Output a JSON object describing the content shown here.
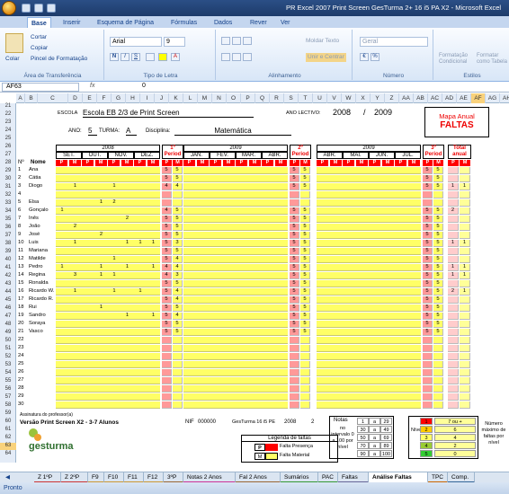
{
  "window": {
    "title": "PR Excel 2007 Print Screen GesTurma 2+ 16 i5 PA X2 - Microsoft Excel"
  },
  "ribbon_tabs": [
    "Base",
    "Inserir",
    "Esquema de Página",
    "Fórmulas",
    "Dados",
    "Rever",
    "Ver"
  ],
  "ribbon": {
    "paste": "Colar",
    "cut": "Cortar",
    "copy": "Copiar",
    "format_painter": "Pincel de Formatação",
    "clipboard_group": "Área de Transferência",
    "font_name": "Arial",
    "font_size": "9",
    "font_group": "Tipo de Letra",
    "wrap_text": "Moldar Texto",
    "merge_center": "Unir e Centrar",
    "alignment_group": "Alinhamento",
    "number_format": "Geral",
    "number_group": "Número",
    "conditional_format": "Formatação Condicional",
    "format_table": "Formatar como Tabela",
    "styles_group": "Estilos"
  },
  "formula_bar": {
    "name_box": "AF63",
    "fx": "fx",
    "value": "0"
  },
  "columns": [
    "A",
    "B",
    "C",
    "D",
    "E",
    "F",
    "G",
    "H",
    "I",
    "J",
    "K",
    "L",
    "M",
    "N",
    "O",
    "P",
    "Q",
    "R",
    "S",
    "T",
    "U",
    "V",
    "W",
    "X",
    "Y",
    "Z",
    "AA",
    "AB",
    "AC",
    "AD",
    "AE",
    "AF",
    "AG",
    "AH"
  ],
  "selected_column": "AF",
  "rows": [
    "21",
    "22",
    "23",
    "24",
    "25",
    "26",
    "27",
    "28",
    "29",
    "30",
    "31",
    "32",
    "33",
    "34",
    "35",
    "36",
    "37",
    "38",
    "39",
    "40",
    "41",
    "42",
    "43",
    "44",
    "45",
    "46",
    "47",
    "48",
    "49",
    "50",
    "51",
    "52",
    "53",
    "54",
    "55",
    "56",
    "57",
    "58",
    "59",
    "60",
    "61",
    "62",
    "63",
    "64"
  ],
  "selected_row": "63",
  "header": {
    "escola_label": "ESCOLA",
    "escola": "Escola EB 2/3 de Print Screen",
    "ano_lectivo_label": "ANO LECTIVO:",
    "year_start": "2008",
    "slash": "/",
    "year_end": "2009",
    "ano_label": "ANO:",
    "ano": "5",
    "turma_label": "TURMA:",
    "turma": "A",
    "disciplina_label": "Disciplina:",
    "disciplina": "Matemática",
    "mapa_title": "Mapa Anual",
    "mapa_sub": "FALTAS"
  },
  "periods": {
    "year1": "2008",
    "year2": "2009",
    "year3": "2009",
    "p1": "1º Period",
    "p2": "2º Period",
    "p3": "3º Period",
    "total": "Total anual",
    "months1": [
      "SET.",
      "OUT.",
      "NOV.",
      "DEZ."
    ],
    "months2": [
      "JAN.",
      "FEV.",
      "MAR.",
      "ABR."
    ],
    "months3": [
      "ABR.",
      "MAI.",
      "JUN.",
      "JUL."
    ],
    "pm": [
      "P",
      "M"
    ],
    "no_label": "Nº",
    "nome_label": "Nome"
  },
  "students": [
    {
      "n": "1",
      "name": "Ana",
      "m": [
        "",
        "",
        "",
        "",
        "",
        "",
        "",
        ""
      ],
      "t1": [
        "5",
        "5"
      ],
      "t2": [
        "5",
        "5"
      ],
      "t3": [
        "5",
        "5"
      ],
      "tot": [
        "",
        ""
      ]
    },
    {
      "n": "2",
      "name": "Cátia",
      "m": [
        "",
        "",
        "",
        "",
        "",
        "",
        "",
        ""
      ],
      "t1": [
        "5",
        "5"
      ],
      "t2": [
        "5",
        "5"
      ],
      "t3": [
        "5",
        "5"
      ],
      "tot": [
        "",
        ""
      ]
    },
    {
      "n": "3",
      "name": "Diogo",
      "m": [
        "",
        "1",
        "",
        "",
        "1",
        "",
        "",
        ""
      ],
      "t1": [
        "4",
        "4"
      ],
      "t2": [
        "5",
        "5"
      ],
      "t3": [
        "5",
        "5"
      ],
      "tot": [
        "1",
        "1"
      ]
    },
    {
      "n": "4",
      "name": "",
      "m": [
        "",
        "",
        "",
        "",
        "",
        "",
        "",
        ""
      ],
      "t1": [
        "",
        ""
      ],
      "t2": [
        "",
        ""
      ],
      "t3": [
        "",
        ""
      ],
      "tot": [
        "",
        ""
      ]
    },
    {
      "n": "5",
      "name": "Elsa",
      "m": [
        "",
        "",
        "",
        "1",
        "2",
        "",
        "",
        ""
      ],
      "t1": [
        "",
        ""
      ],
      "t2": [
        "",
        ""
      ],
      "t3": [
        "",
        ""
      ],
      "tot": [
        "",
        ""
      ]
    },
    {
      "n": "6",
      "name": "Gonçalo",
      "m": [
        "1",
        "",
        "",
        "",
        "",
        "",
        "",
        ""
      ],
      "t1": [
        "4",
        "5"
      ],
      "t2": [
        "5",
        "5"
      ],
      "t3": [
        "5",
        "5"
      ],
      "tot": [
        "2",
        ""
      ]
    },
    {
      "n": "7",
      "name": "Inês",
      "m": [
        "",
        "",
        "",
        "",
        "",
        "2",
        "",
        ""
      ],
      "t1": [
        "5",
        "5"
      ],
      "t2": [
        "5",
        "5"
      ],
      "t3": [
        "5",
        "5"
      ],
      "tot": [
        "",
        ""
      ]
    },
    {
      "n": "8",
      "name": "João",
      "m": [
        "",
        "2",
        "",
        "",
        "",
        "",
        "",
        ""
      ],
      "t1": [
        "5",
        "5"
      ],
      "t2": [
        "5",
        "5"
      ],
      "t3": [
        "5",
        "5"
      ],
      "tot": [
        "",
        ""
      ]
    },
    {
      "n": "9",
      "name": "José",
      "m": [
        "",
        "",
        "",
        "2",
        "",
        "",
        "",
        ""
      ],
      "t1": [
        "5",
        "5"
      ],
      "t2": [
        "5",
        "5"
      ],
      "t3": [
        "5",
        "5"
      ],
      "tot": [
        "",
        ""
      ]
    },
    {
      "n": "10",
      "name": "Luis",
      "m": [
        "",
        "1",
        "",
        "",
        "",
        "1",
        "1",
        "1"
      ],
      "t1": [
        "5",
        "3"
      ],
      "t2": [
        "5",
        "5"
      ],
      "t3": [
        "5",
        "5"
      ],
      "tot": [
        "1",
        "1"
      ]
    },
    {
      "n": "11",
      "name": "Mariana",
      "m": [
        "",
        "",
        "",
        "",
        "",
        "",
        "",
        ""
      ],
      "t1": [
        "5",
        "5"
      ],
      "t2": [
        "5",
        "5"
      ],
      "t3": [
        "5",
        "5"
      ],
      "tot": [
        "",
        ""
      ]
    },
    {
      "n": "12",
      "name": "Matilde",
      "m": [
        "",
        "",
        "",
        "",
        "1",
        "",
        "",
        ""
      ],
      "t1": [
        "5",
        "4"
      ],
      "t2": [
        "5",
        "5"
      ],
      "t3": [
        "5",
        "5"
      ],
      "tot": [
        "",
        ""
      ]
    },
    {
      "n": "13",
      "name": "Pedro",
      "m": [
        "1",
        "",
        "",
        "1",
        "",
        "1",
        "",
        "1"
      ],
      "t1": [
        "4",
        "4"
      ],
      "t2": [
        "5",
        "5"
      ],
      "t3": [
        "5",
        "5"
      ],
      "tot": [
        "1",
        "1"
      ]
    },
    {
      "n": "14",
      "name": "Regina",
      "m": [
        "",
        "3",
        "",
        "1",
        "1",
        "",
        "",
        ""
      ],
      "t1": [
        "4",
        "3"
      ],
      "t2": [
        "5",
        "5"
      ],
      "t3": [
        "5",
        "5"
      ],
      "tot": [
        "1",
        "1"
      ]
    },
    {
      "n": "15",
      "name": "Ronalda",
      "m": [
        "",
        "",
        "",
        "",
        "",
        "",
        "",
        ""
      ],
      "t1": [
        "5",
        "5"
      ],
      "t2": [
        "5",
        "5"
      ],
      "t3": [
        "5",
        "5"
      ],
      "tot": [
        "",
        ""
      ]
    },
    {
      "n": "16",
      "name": "Ricardo W.",
      "m": [
        "",
        "1",
        "",
        "",
        "1",
        "",
        "1",
        ""
      ],
      "t1": [
        "5",
        "4"
      ],
      "t2": [
        "5",
        "5"
      ],
      "t3": [
        "5",
        "5"
      ],
      "tot": [
        "2",
        "1"
      ]
    },
    {
      "n": "17",
      "name": "Ricardo R.",
      "m": [
        "",
        "",
        "",
        "",
        "",
        "",
        "",
        ""
      ],
      "t1": [
        "5",
        "4"
      ],
      "t2": [
        "5",
        "5"
      ],
      "t3": [
        "5",
        "5"
      ],
      "tot": [
        "",
        ""
      ]
    },
    {
      "n": "18",
      "name": "Rui",
      "m": [
        "",
        "",
        "",
        "1",
        "",
        "",
        "",
        ""
      ],
      "t1": [
        "5",
        "5"
      ],
      "t2": [
        "5",
        "5"
      ],
      "t3": [
        "5",
        "5"
      ],
      "tot": [
        "",
        ""
      ]
    },
    {
      "n": "19",
      "name": "Sandro",
      "m": [
        "",
        "",
        "",
        "",
        "",
        "1",
        "",
        "1"
      ],
      "t1": [
        "5",
        "4"
      ],
      "t2": [
        "5",
        "5"
      ],
      "t3": [
        "5",
        "5"
      ],
      "tot": [
        "",
        ""
      ]
    },
    {
      "n": "20",
      "name": "Soraya",
      "m": [
        "",
        "",
        "",
        "",
        "",
        "",
        "",
        ""
      ],
      "t1": [
        "5",
        "5"
      ],
      "t2": [
        "5",
        "5"
      ],
      "t3": [
        "5",
        "5"
      ],
      "tot": [
        "",
        ""
      ]
    },
    {
      "n": "21",
      "name": "Vasco",
      "m": [
        "",
        "",
        "",
        "",
        "",
        "",
        "",
        ""
      ],
      "t1": [
        "5",
        "5"
      ],
      "t2": [
        "5",
        "5"
      ],
      "t3": [
        "5",
        "5"
      ],
      "tot": [
        "",
        ""
      ]
    },
    {
      "n": "22",
      "name": "",
      "m": [
        "",
        "",
        "",
        "",
        "",
        "",
        "",
        ""
      ],
      "t1": [
        "",
        ""
      ],
      "t2": [
        "",
        ""
      ],
      "t3": [
        "",
        ""
      ],
      "tot": [
        "",
        ""
      ]
    },
    {
      "n": "23",
      "name": "",
      "m": [
        "",
        "",
        "",
        "",
        "",
        "",
        "",
        ""
      ],
      "t1": [
        "",
        ""
      ],
      "t2": [
        "",
        ""
      ],
      "t3": [
        "",
        ""
      ],
      "tot": [
        "",
        ""
      ]
    },
    {
      "n": "24",
      "name": "",
      "m": [
        "",
        "",
        "",
        "",
        "",
        "",
        "",
        ""
      ],
      "t1": [
        "",
        ""
      ],
      "t2": [
        "",
        ""
      ],
      "t3": [
        "",
        ""
      ],
      "tot": [
        "",
        ""
      ]
    },
    {
      "n": "25",
      "name": "",
      "m": [
        "",
        "",
        "",
        "",
        "",
        "",
        "",
        ""
      ],
      "t1": [
        "",
        ""
      ],
      "t2": [
        "",
        ""
      ],
      "t3": [
        "",
        ""
      ],
      "tot": [
        "",
        ""
      ]
    },
    {
      "n": "26",
      "name": "",
      "m": [
        "",
        "",
        "",
        "",
        "",
        "",
        "",
        ""
      ],
      "t1": [
        "",
        ""
      ],
      "t2": [
        "",
        ""
      ],
      "t3": [
        "",
        ""
      ],
      "tot": [
        "",
        ""
      ]
    },
    {
      "n": "27",
      "name": "",
      "m": [
        "",
        "",
        "",
        "",
        "",
        "",
        "",
        ""
      ],
      "t1": [
        "",
        ""
      ],
      "t2": [
        "",
        ""
      ],
      "t3": [
        "",
        ""
      ],
      "tot": [
        "",
        ""
      ]
    },
    {
      "n": "28",
      "name": "",
      "m": [
        "",
        "",
        "",
        "",
        "",
        "",
        "",
        ""
      ],
      "t1": [
        "",
        ""
      ],
      "t2": [
        "",
        ""
      ],
      "t3": [
        "",
        ""
      ],
      "tot": [
        "",
        ""
      ]
    },
    {
      "n": "29",
      "name": "",
      "m": [
        "",
        "",
        "",
        "",
        "",
        "",
        "",
        ""
      ],
      "t1": [
        "",
        ""
      ],
      "t2": [
        "",
        ""
      ],
      "t3": [
        "",
        ""
      ],
      "tot": [
        "",
        ""
      ]
    },
    {
      "n": "30",
      "name": "",
      "m": [
        "",
        "",
        "",
        "",
        "",
        "",
        "",
        ""
      ],
      "t1": [
        "",
        ""
      ],
      "t2": [
        "",
        ""
      ],
      "t3": [
        "",
        ""
      ],
      "tot": [
        "",
        ""
      ]
    }
  ],
  "footer": {
    "assinatura": "Assinatura do professor(a)",
    "version": "Versão Print Screen X2 - 3-7 Alunos",
    "nif_label": "NIF",
    "nif": "000000",
    "product": "GesTurma 16 i5 PE",
    "year": "2008",
    "num": "2",
    "logo": "gesturma",
    "legend_title": "Legenda de faltas",
    "legend_p_key": "P",
    "legend_p": "Falta Presença",
    "legend_m_key": "M",
    "legend_m": "Falta Material",
    "notas_label": "Notas",
    "notas_desc": "no intervalo 0 a 100 por nível",
    "notas_rows": [
      [
        "1",
        "a",
        "29"
      ],
      [
        "30",
        "a",
        "49"
      ],
      [
        "50",
        "a",
        "69"
      ],
      [
        "70",
        "a",
        "89"
      ],
      [
        "90",
        "a",
        "100"
      ]
    ],
    "nivel_label": "Nível",
    "nivel_rows": [
      {
        "level": "1",
        "value": "7 ou +",
        "color": "#ff0000"
      },
      {
        "level": "2",
        "value": "6",
        "color": "#ffcc00"
      },
      {
        "level": "3",
        "value": "4",
        "color": "#ffff66"
      },
      {
        "level": "4",
        "value": "2",
        "color": "#99cc33"
      },
      {
        "level": "5",
        "value": "0",
        "color": "#33cc33"
      }
    ],
    "max_label": "Número máximo de faltas por nível"
  },
  "sheet_tabs": [
    "Z 1ºP",
    "Z 2ºP",
    "F9",
    "F10",
    "F11",
    "F12",
    "3ºP",
    "Notas 2 Anos",
    "Fal 2 Anos",
    "Sumários",
    "PAC",
    "Faltas",
    "Análise Faltas",
    "TPC",
    "Comp."
  ],
  "active_sheet": "Análise Faltas",
  "status": {
    "text": "Pronto"
  },
  "colors": {
    "yellow": "#ffff66",
    "red": "#ff0000",
    "grey": "#d0d0d0",
    "accent": "#2b4f86"
  }
}
